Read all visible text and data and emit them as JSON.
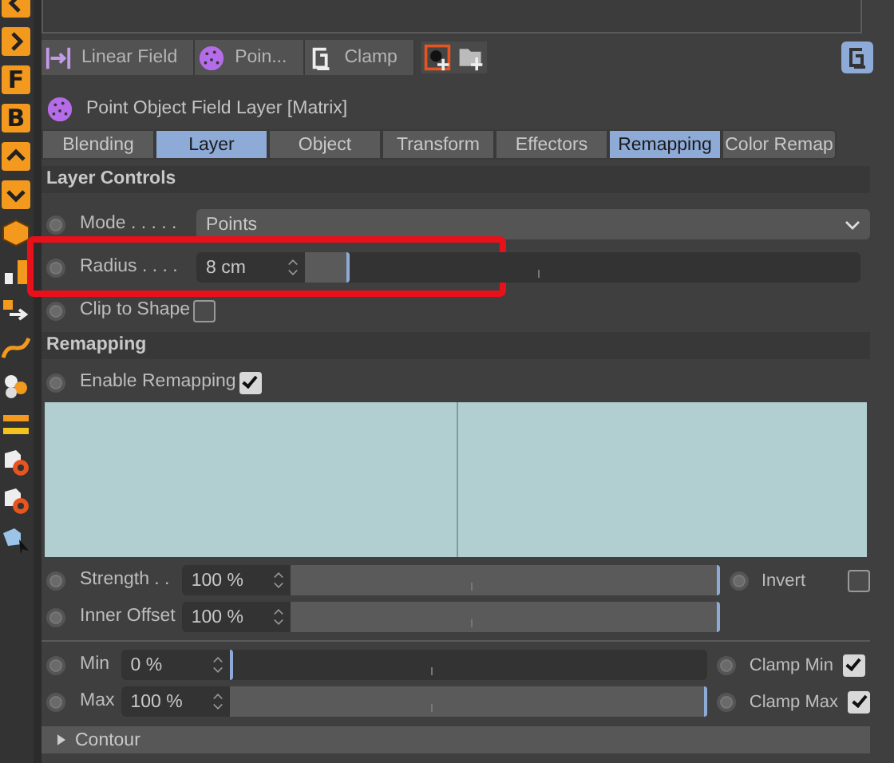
{
  "toolbar": [
    {
      "kind": "chevron-left"
    },
    {
      "kind": "chevron-right"
    },
    {
      "kind": "letter",
      "glyph": "F"
    },
    {
      "kind": "letter",
      "glyph": "B"
    },
    {
      "kind": "chevron-up"
    },
    {
      "kind": "chevron-down"
    },
    {
      "kind": "cube"
    },
    {
      "kind": "bars"
    },
    {
      "kind": "arrow"
    },
    {
      "kind": "spline"
    },
    {
      "kind": "spheres"
    },
    {
      "kind": "strip"
    },
    {
      "kind": "gear-cube"
    },
    {
      "kind": "gear-cube"
    },
    {
      "kind": "cursor-cube"
    }
  ],
  "layer_strip": {
    "layers": [
      {
        "kind": "linear",
        "label": "Linear Field"
      },
      {
        "kind": "point",
        "label": "Poin..."
      },
      {
        "kind": "clamp",
        "label": "Clamp"
      }
    ],
    "actions": [
      {
        "kind": "add-layer"
      },
      {
        "kind": "add-folder"
      }
    ],
    "lock": {
      "kind": "clamp",
      "selected": true
    }
  },
  "title": "Point Object Field Layer [Matrix]",
  "tabs": [
    {
      "label": "Blending",
      "selected": false
    },
    {
      "label": "Layer",
      "selected": true
    },
    {
      "label": "Object",
      "selected": false
    },
    {
      "label": "Transform",
      "selected": false
    },
    {
      "label": "Effectors",
      "selected": false
    },
    {
      "label": "Remapping",
      "selected": true
    },
    {
      "label": "Color Remap",
      "selected": false
    }
  ],
  "sections": [
    {
      "title": "Layer Controls",
      "blocks": [
        [
          {
            "kind": "dropdown",
            "label": "Mode . . . . .",
            "value": "Points"
          },
          {
            "kind": "slider",
            "label": "Radius . . . .",
            "value": "8 cm",
            "level": 0.08,
            "highlighted": true
          },
          {
            "kind": "checkbox",
            "label": "Clip to Shape",
            "checked": false
          }
        ]
      ]
    },
    {
      "title": "Remapping",
      "blocks": [
        [
          {
            "kind": "checkbox",
            "label": "Enable Remapping",
            "checked": true
          }
        ],
        [
          {
            "kind": "graph"
          }
        ],
        [
          {
            "kind": "slider",
            "label": "Strength . .",
            "value": "100 %",
            "level": 1,
            "side": {
              "label": "Invert",
              "checked": false
            }
          },
          {
            "kind": "slider",
            "label": "Inner Offset",
            "value": "100 %",
            "level": 1
          }
        ],
        [
          {
            "kind": "slider",
            "label": "Min",
            "value": "0 %",
            "level": 0,
            "side": {
              "label": "Clamp Min",
              "checked": true
            }
          },
          {
            "kind": "slider",
            "label": "Max",
            "value": "100 %",
            "level": 1,
            "side": {
              "label": "Clamp Max",
              "checked": true
            }
          }
        ]
      ]
    }
  ],
  "collapsed_group": {
    "label": "Contour",
    "expanded": false
  }
}
